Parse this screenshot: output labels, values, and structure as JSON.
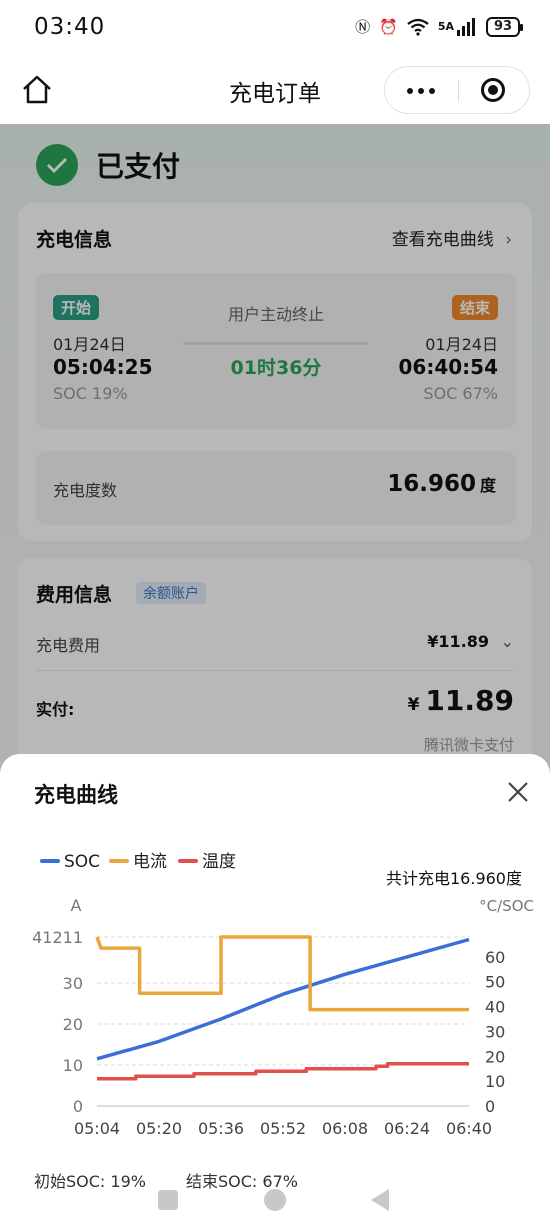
{
  "status_bar": {
    "time": "03:40",
    "network": "5A",
    "battery": "93"
  },
  "nav": {
    "title": "充电订单"
  },
  "order": {
    "status": "已支付",
    "charging_info": {
      "title": "充电信息",
      "curve_link": "查看充电曲线",
      "start_tag": "开始",
      "end_tag": "结束",
      "start_date": "01月24日",
      "start_time": "05:04:25",
      "start_soc": "SOC 19%",
      "end_date": "01月24日",
      "end_time": "06:40:54",
      "end_soc": "SOC 67%",
      "stop_reason": "用户主动终止",
      "duration": "01时36分",
      "kwh_label": "充电度数",
      "kwh_value": "16.960",
      "kwh_unit": "度"
    },
    "fee_info": {
      "title": "费用信息",
      "badge": "余额账户",
      "fee_label": "充电费用",
      "fee_value": "¥11.89",
      "paid_label": "实付:",
      "paid_currency": "¥",
      "paid_amount": "11.89",
      "pay_method": "腾讯微卡支付"
    }
  },
  "sheet": {
    "title": "充电曲线",
    "total_text": "共计充电16.960度",
    "initial_soc_text": "初始SOC:  19%",
    "end_soc_text": "结束SOC:  67%"
  },
  "chart_data": {
    "type": "line",
    "title": "共计充电16.960度",
    "x": [
      "05:04",
      "05:20",
      "05:36",
      "05:52",
      "06:08",
      "06:24",
      "06:40"
    ],
    "left_axis": {
      "label": "A",
      "ylim": [
        0,
        41.211
      ],
      "ticks": [
        0,
        10,
        20,
        30,
        41.211
      ],
      "tick_labels": [
        "0",
        "10",
        "20",
        "30",
        "41211"
      ]
    },
    "right_axis": {
      "label": "°C/SOC",
      "ylim": [
        0,
        68
      ],
      "ticks": [
        0,
        10,
        20,
        30,
        40,
        50,
        60
      ],
      "tick_labels": [
        "0",
        "10",
        "20",
        "30",
        "40",
        "50",
        "60"
      ]
    },
    "legend_position": "top-left",
    "grid": true,
    "series": [
      {
        "name": "SOC",
        "axis": "right",
        "color": "#3b6fd8",
        "points": [
          [
            "05:04",
            19
          ],
          [
            "05:20",
            26
          ],
          [
            "05:36",
            35
          ],
          [
            "05:52",
            45
          ],
          [
            "06:08",
            53
          ],
          [
            "06:24",
            60
          ],
          [
            "06:40",
            67
          ]
        ]
      },
      {
        "name": "电流",
        "axis": "left",
        "color": "#e9a73b",
        "points": [
          [
            "05:04",
            41.2
          ],
          [
            "05:05",
            38.5
          ],
          [
            "05:15",
            38.5
          ],
          [
            "05:15",
            27.5
          ],
          [
            "05:36",
            27.5
          ],
          [
            "05:36",
            41.2
          ],
          [
            "05:59",
            41.2
          ],
          [
            "05:59",
            23.5
          ],
          [
            "06:40",
            23.5
          ]
        ]
      },
      {
        "name": "温度",
        "axis": "right",
        "color": "#e0504c",
        "points": [
          [
            "05:04",
            11
          ],
          [
            "05:14",
            11
          ],
          [
            "05:14",
            12
          ],
          [
            "05:29",
            12
          ],
          [
            "05:29",
            13
          ],
          [
            "05:45",
            13
          ],
          [
            "05:45",
            14
          ],
          [
            "05:58",
            14
          ],
          [
            "05:58",
            15
          ],
          [
            "06:16",
            15
          ],
          [
            "06:16",
            16
          ],
          [
            "06:19",
            16
          ],
          [
            "06:19",
            17
          ],
          [
            "06:40",
            17
          ]
        ]
      }
    ]
  }
}
